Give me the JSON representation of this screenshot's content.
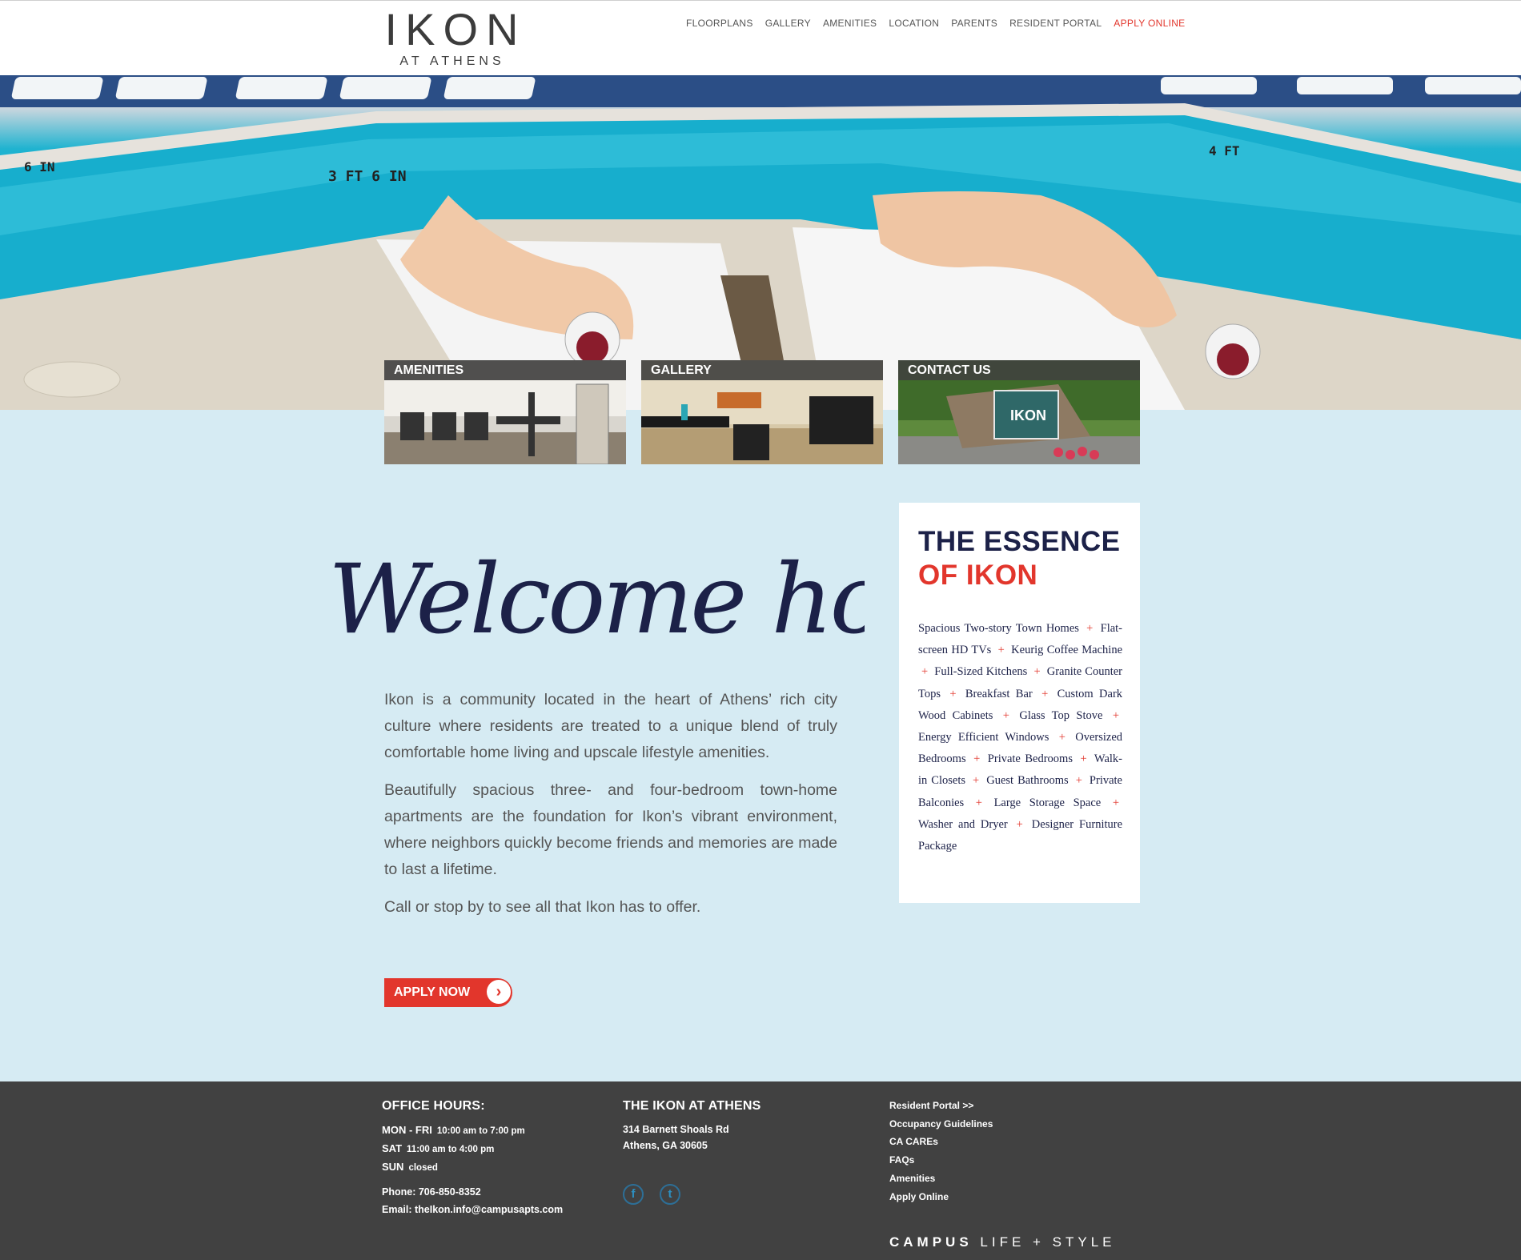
{
  "brand": {
    "name": "IKON",
    "subtitle": "AT ATHENS"
  },
  "nav": {
    "items": [
      "FLOORPLANS",
      "GALLERY",
      "AMENITIES",
      "LOCATION",
      "PARENTS",
      "RESIDENT PORTAL"
    ],
    "apply": "APPLY ONLINE"
  },
  "hero": {
    "pool_depth_markers": [
      "6 IN",
      "3 FT 6 IN",
      "4 FT"
    ]
  },
  "cards": [
    {
      "label": "AMENITIES"
    },
    {
      "label": "GALLERY"
    },
    {
      "label": "CONTACT US"
    }
  ],
  "welcome": {
    "heading": "Welcome home"
  },
  "intro": {
    "p1": "Ikon is a community located in the heart of Athens’ rich city culture where residents are treated to a unique blend of truly comfortable home living and upscale lifestyle amenities.",
    "p2": "Beautifully spacious three- and four-bedroom town-home apartments are the foundation for Ikon’s vibrant environment, where neighbors quickly become friends and memories are made to last a lifetime.",
    "p3": "Call or stop by to see all that Ikon has to offer.",
    "apply_button": "APPLY NOW"
  },
  "essence": {
    "title_line1": "THE ESSENCE",
    "title_line2": "OF IKON",
    "features": [
      "Spacious Two-story Town Homes",
      "Flat-screen HD TVs",
      "Keurig Coffee Machine",
      "Full-Sized Kitchens",
      "Granite Counter Tops",
      "Breakfast Bar",
      "Custom Dark Wood Cabinets",
      "Glass Top Stove",
      "Energy Efficient Windows",
      "Oversized Bedrooms",
      "Private Bedrooms",
      "Walk-in Closets",
      "Guest Bathrooms",
      "Private Balconies",
      "Large Storage Space",
      "Washer and Dryer",
      "Designer Furniture Package"
    ],
    "separator": "+"
  },
  "footer": {
    "hours_heading": "OFFICE HOURS:",
    "hours": [
      {
        "day": "MON - FRI",
        "time": "10:00 am to 7:00 pm"
      },
      {
        "day": "SAT",
        "time": "11:00 am to 4:00 pm"
      },
      {
        "day": "SUN",
        "time": "closed"
      }
    ],
    "phone": "Phone: 706-850-8352",
    "email": "Email: theIkon.info@campusapts.com",
    "address_heading": "THE IKON AT ATHENS",
    "address_line1": "314 Barnett Shoals Rd",
    "address_line2": "Athens, GA 30605",
    "links": [
      "Resident Portal >>",
      "Occupancy Guidelines",
      "CA CAREs",
      "FAQs",
      "Amenities",
      "Apply Online"
    ],
    "social": [
      {
        "icon": "facebook-icon",
        "glyph": "f"
      },
      {
        "icon": "twitter-icon",
        "glyph": "t"
      }
    ],
    "tagline_bold": "CAMPUS",
    "tagline_rest": " LIFE + STYLE"
  },
  "colors": {
    "accent": "#e2362c",
    "navy": "#1c2148",
    "page_bg": "#d6ebf3",
    "footer_bg": "#414141"
  }
}
